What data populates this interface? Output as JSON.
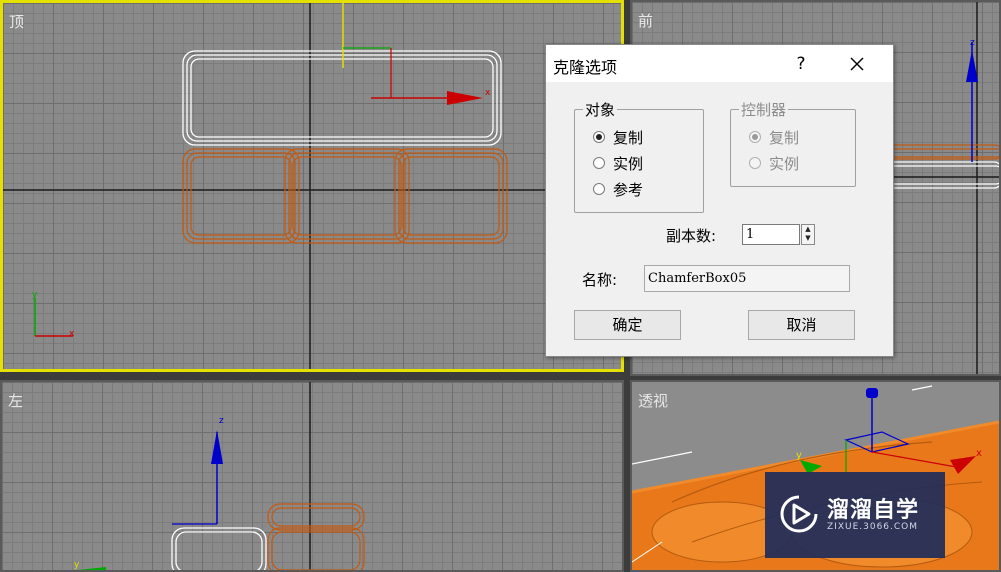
{
  "viewports": {
    "top_label": "顶",
    "front_label": "前",
    "left_label": "左",
    "perspective_label": "透视",
    "active_border_color": "#e4e000",
    "selection_color": "#ffffff",
    "copies_color": "#c45a10",
    "axis_x_color": "#cc0000",
    "axis_y_color": "#00aa00",
    "axis_z_color": "#0000cc"
  },
  "dialog": {
    "title": "克隆选项",
    "help": "?",
    "close": "✕",
    "object_group": {
      "legend": "对象",
      "options": [
        "复制",
        "实例",
        "参考"
      ],
      "selected": "复制"
    },
    "controller_group": {
      "legend": "控制器",
      "options": [
        "复制",
        "实例"
      ],
      "selected": "复制",
      "disabled": true
    },
    "copies_label": "副本数:",
    "copies_value": "1",
    "name_label": "名称:",
    "name_value": "ChamferBox05",
    "ok": "确定",
    "cancel": "取消"
  },
  "watermark": {
    "brand": "溜溜自学",
    "url": "ZIXUE.3066.COM",
    "bg_color": "#1e2d5a"
  }
}
